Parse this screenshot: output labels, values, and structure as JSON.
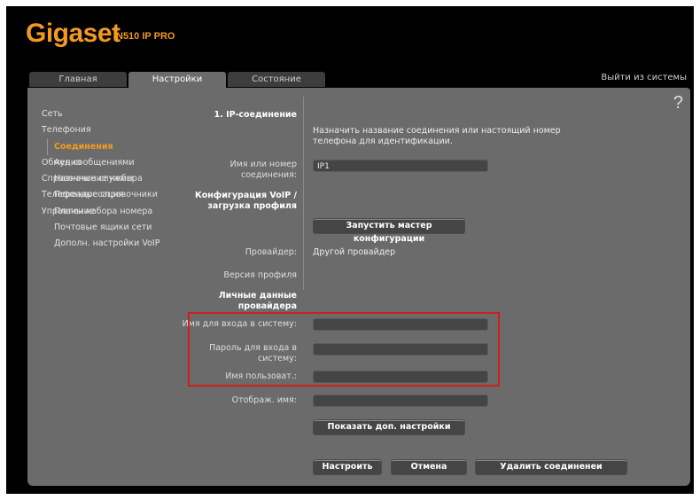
{
  "brand": {
    "logo": "Gigaset",
    "model": "N510 IP PRO"
  },
  "tabs": [
    {
      "label": "Главная"
    },
    {
      "label": "Настройки"
    },
    {
      "label": "Состояние"
    }
  ],
  "logout_label": "Выйти из системы",
  "help_label": "?",
  "sidebar": {
    "items": [
      {
        "label": "Сеть"
      },
      {
        "label": "Телефония"
      }
    ],
    "sub_items": [
      {
        "label": "Соединения"
      },
      {
        "label": "Аудио"
      },
      {
        "label": "Назначение номера"
      },
      {
        "label": "Переадресация"
      },
      {
        "label": "Планы набора номера"
      },
      {
        "label": "Почтовые ящики сети"
      },
      {
        "label": "Дополн. настройки VoIP"
      }
    ],
    "bottom_items": [
      {
        "label": "Обмен сообщениями"
      },
      {
        "label": "Справочные службы"
      },
      {
        "label": "Телефонные справочники"
      },
      {
        "label": "Управление"
      }
    ]
  },
  "form": {
    "section_title": "1. IP-соединение",
    "description": "Назначить название соединения или настоящий номер телефона для идентификации.",
    "name_label": "Имя или номер соединения:",
    "name_value": "IP1",
    "voip_title": "Конфигурация VoIP / загрузка профиля",
    "wizard_button": "Запустить мастер конфигурации",
    "provider_label": "Провайдер:",
    "provider_value": "Другой провайдер",
    "profile_label": "Версия профиля",
    "provider_data_title": "Личные данные провайдера",
    "login_label": "Имя для входа в систему:",
    "login_value": "",
    "password_label": "Пароль для входа в систему:",
    "password_value": "",
    "username_label": "Имя пользоват.:",
    "username_value": "",
    "display_label": "Отображ. имя:",
    "display_value": "",
    "more_button": "Показать доп. настройки",
    "configure_button": "Настроить",
    "cancel_button": "Отмена",
    "delete_button": "Удалить соединенеи"
  },
  "colors": {
    "accent": "#f39a1e",
    "panel": "#6b6b6b",
    "highlight": "#cc1f1f"
  }
}
